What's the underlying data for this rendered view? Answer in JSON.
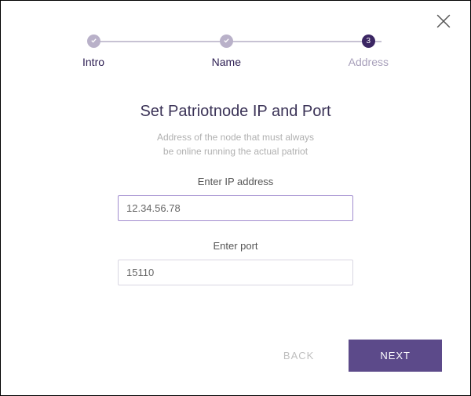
{
  "stepper": {
    "steps": [
      {
        "label": "Intro",
        "status": "done"
      },
      {
        "label": "Name",
        "status": "done"
      },
      {
        "label": "Address",
        "status": "active",
        "number": "3"
      }
    ]
  },
  "content": {
    "title": "Set Patriotnode IP and Port",
    "subtitle_line1": "Address of the node that must always",
    "subtitle_line2": "be online running the actual patriot",
    "ip_label": "Enter IP address",
    "ip_value": "12.34.56.78",
    "port_label": "Enter port",
    "port_value": "15110"
  },
  "footer": {
    "back_label": "BACK",
    "next_label": "NEXT"
  }
}
